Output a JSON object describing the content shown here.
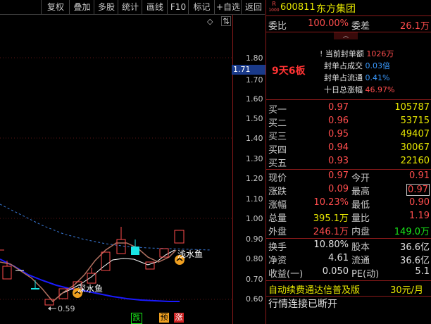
{
  "toolbar": {
    "items": [
      "复权",
      "叠加",
      "多股",
      "统计",
      "画线",
      "F10",
      "标记",
      "+自选",
      "返回"
    ]
  },
  "chart": {
    "price_labels": [
      "1.80",
      "1.70",
      "1.60",
      "1.50",
      "1.40",
      "1.30",
      "1.20",
      "1.10",
      "1.00",
      "0.90",
      "0.80",
      "0.70",
      "0.60"
    ],
    "current_price_tag": "1.71",
    "streak_label": "9天6板",
    "low_marker": "0.59",
    "fish_label_1": "浅水鱼",
    "fish_label_2": "深水鱼",
    "bottom_tags": [
      "跌",
      "预",
      "涨"
    ],
    "diamond": "◇",
    "sort_icon": "⇅"
  },
  "panel": {
    "badge_top": "R",
    "badge_bottom": "1000",
    "stock_code": "600811",
    "stock_name": "东方集团",
    "wei_bi_label": "委比",
    "wei_bi_value": "100.00%",
    "wei_cha_label": "委差",
    "wei_cha_value": "26.1万",
    "seal_amount_label": "当前封单额",
    "seal_amount_value": "1026万",
    "seal_trade_label": "封单占成交",
    "seal_trade_value": "0.03倍",
    "seal_float_label": "封单占流通",
    "seal_float_value": "0.41%",
    "ten_day_label": "十日总涨幅",
    "ten_day_value": "46.97%",
    "bids": [
      {
        "label": "买一",
        "price": "0.97",
        "vol": "105787"
      },
      {
        "label": "买二",
        "price": "0.96",
        "vol": "53715"
      },
      {
        "label": "买三",
        "price": "0.95",
        "vol": "49407"
      },
      {
        "label": "买四",
        "price": "0.94",
        "vol": "30067"
      },
      {
        "label": "买五",
        "price": "0.93",
        "vol": "22160"
      }
    ],
    "stats": [
      {
        "l1": "现价",
        "v1": "0.97",
        "l2": "今开",
        "v2": "0.91"
      },
      {
        "l1": "涨跌",
        "v1": "0.09",
        "l2": "最高",
        "v2": "0.97"
      },
      {
        "l1": "涨幅",
        "v1": "10.23%",
        "l2": "最低",
        "v2": "0.90"
      },
      {
        "l1": "总量",
        "v1": "395.1万",
        "l2": "量比",
        "v2": "1.19"
      },
      {
        "l1": "外盘",
        "v1": "246.1万",
        "l2": "内盘",
        "v2": "149.0万"
      }
    ],
    "stats2": [
      {
        "l1": "换手",
        "v1": "10.80%",
        "l2": "股本",
        "v2": "36.6亿"
      },
      {
        "l1": "净资",
        "v1": "4.61",
        "l2": "流通",
        "v2": "36.6亿"
      },
      {
        "l1": "收益(一)",
        "v1": "0.050",
        "l2": "PE(动)",
        "v2": "5.1"
      }
    ],
    "subscription": "自动续费通达信普及版",
    "price_month": "30元/月",
    "status": "行情连接已断开"
  },
  "colors": {
    "up": "#ff4d4d",
    "down": "#19e619",
    "frame": "#8b1a1a",
    "ma_blue": "#1a1aff"
  }
}
